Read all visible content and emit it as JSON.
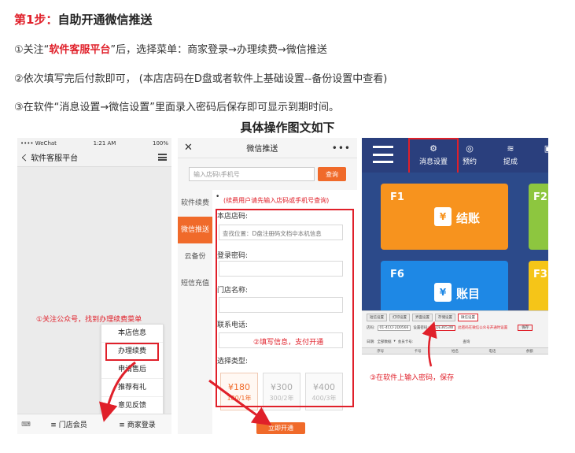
{
  "heading": {
    "step": "第1步：",
    "title": "自助开通微信推送"
  },
  "lines": {
    "l1_prefix": "①关注“",
    "l1_highlight": "软件客服平台",
    "l1_suffix": "”后，选择菜单：商家登录→办理续费→微信推送",
    "l2": "②依次填写完后付款即可，  (本店店码在D盘或者软件上基础设置--备份设置中查看)",
    "l3": "③在软件“消息设置→微信设置”里面录入密码后保存即可显示到期时间。"
  },
  "subtitle": "具体操作图文如下",
  "panel1": {
    "carrier": "•••• WeChat",
    "time": "1:21 AM",
    "battery": "100%",
    "back": "く",
    "title": "软件客服平台",
    "note": "①关注公众号，找到办理续费菜单",
    "menu": [
      "本店信息",
      "办理续费",
      "申请售后",
      "推荐有礼",
      "意见反馈"
    ],
    "bottom": {
      "keyboard": "⌨",
      "left": "≡ 门店会员",
      "right": "≡ 商家登录"
    }
  },
  "panel2": {
    "close": "✕",
    "title": "微信推送",
    "more": "•••",
    "search_placeholder": "输入店码\\手机号",
    "search_button": "查询",
    "sidebar": [
      "软件续费",
      "微信推送",
      "云备份",
      "短信充值"
    ],
    "active_tab": "微信推送",
    "bullet": "•",
    "hint": "(续费用户请先输入店码或手机号查询)",
    "labels": {
      "store_code": "本店店码:",
      "password": "登录密码:",
      "store_name": "门店名称:",
      "phone": "联系电话:",
      "type": "选择类型:"
    },
    "store_code_placeholder": "查找位置：D盘注册码文档中本机信息",
    "note": "②填写信息，支付开通",
    "options": [
      {
        "price": "¥180",
        "period": "180/1年"
      },
      {
        "price": "¥300",
        "period": "300/2年"
      },
      {
        "price": "¥400",
        "period": "400/3年"
      }
    ],
    "open_button": "立即开通"
  },
  "panel3": {
    "nav": [
      {
        "label": "消息设置",
        "icon": "⚙"
      },
      {
        "label": "预约",
        "icon": "◎"
      },
      {
        "label": "提成",
        "icon": "≋"
      },
      {
        "label": "",
        "icon": "▣"
      }
    ],
    "tiles": [
      {
        "key": "F1",
        "label": "结账",
        "icon": "¥",
        "color": "#f7931e"
      },
      {
        "key": "F2",
        "label": "",
        "icon": "",
        "color": "#8dc63f"
      },
      {
        "key": "F6",
        "label": "账目",
        "icon": "¥",
        "color": "#1e88e5"
      },
      {
        "key": "F3",
        "label": "",
        "icon": "",
        "color": "#f5c518"
      }
    ],
    "dialog": {
      "tabs": [
        "短信设置",
        "打印设置",
        "界面设置",
        "存储设置",
        "微信设置"
      ],
      "row1": [
        "店码:",
        "01-4CCF2D0566",
        "设置密码:",
        "CDE3653W",
        "",
        "",
        "保存"
      ],
      "row1_warn": "此密码在微信公众号开通时设置",
      "row2": [
        "日期:",
        "全部数据",
        "▾",
        "会员卡号:",
        "",
        "",
        "查询"
      ],
      "table_headers": [
        "序号",
        "卡号",
        "姓名",
        "电话",
        "余额"
      ]
    },
    "note": "③在软件上输入密码，保存"
  },
  "colors": {
    "accent_red": "#e0202a",
    "orange": "#f06a2a",
    "navy": "#2a3f7d"
  }
}
